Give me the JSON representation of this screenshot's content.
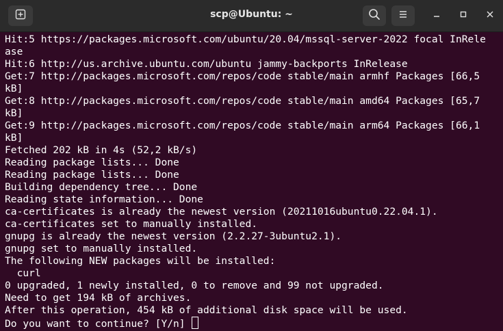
{
  "window": {
    "title": "scp@Ubuntu: ~"
  },
  "icons": {
    "new_tab": "new-tab-icon",
    "search": "search-icon",
    "menu": "hamburger-menu-icon",
    "minimize": "minimize-icon",
    "maximize": "maximize-icon",
    "close": "close-icon"
  },
  "colors": {
    "terminal_bg": "#300a24",
    "titlebar_bg": "#2b2b2b",
    "text": "#ffffff"
  },
  "terminal": {
    "lines": [
      "Hit:5 https://packages.microsoft.com/ubuntu/20.04/mssql-server-2022 focal InRele",
      "ase",
      "Hit:6 http://us.archive.ubuntu.com/ubuntu jammy-backports InRelease",
      "Get:7 http://packages.microsoft.com/repos/code stable/main armhf Packages [66,5",
      "kB]",
      "Get:8 http://packages.microsoft.com/repos/code stable/main amd64 Packages [65,7",
      "kB]",
      "Get:9 http://packages.microsoft.com/repos/code stable/main arm64 Packages [66,1",
      "kB]",
      "Fetched 202 kB in 4s (52,2 kB/s)",
      "Reading package lists... Done",
      "Reading package lists... Done",
      "Building dependency tree... Done",
      "Reading state information... Done",
      "ca-certificates is already the newest version (20211016ubuntu0.22.04.1).",
      "ca-certificates set to manually installed.",
      "gnupg is already the newest version (2.2.27-3ubuntu2.1).",
      "gnupg set to manually installed.",
      "The following NEW packages will be installed:",
      "  curl",
      "0 upgraded, 1 newly installed, 0 to remove and 99 not upgraded.",
      "Need to get 194 kB of archives.",
      "After this operation, 454 kB of additional disk space will be used."
    ],
    "prompt": "Do you want to continue? [Y/n] "
  }
}
